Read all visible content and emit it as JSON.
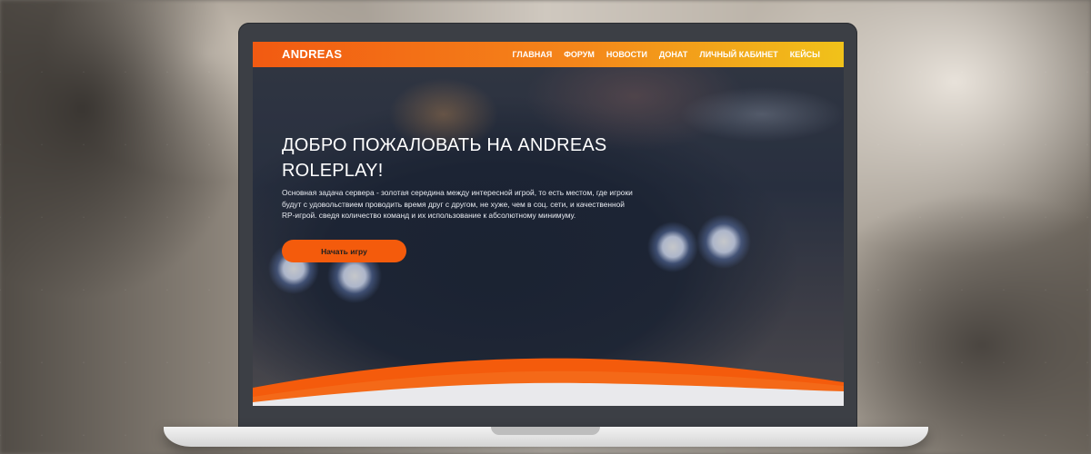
{
  "site": {
    "logo": "ANDREAS"
  },
  "nav": {
    "items": [
      {
        "label": "ГЛАВНАЯ"
      },
      {
        "label": "ФОРУМ"
      },
      {
        "label": "НОВОСТИ"
      },
      {
        "label": "ДОНАТ"
      },
      {
        "label": "ЛИЧНЫЙ КАБИНЕТ"
      },
      {
        "label": "КЕЙСЫ"
      }
    ]
  },
  "hero": {
    "title_line1": "ДОБРО ПОЖАЛОВАТЬ НА ANDREAS",
    "title_line2": "ROLEPLAY!",
    "description": "Основная задача сервера - золотая середина между интересной игрой, то есть местом, где игроки будут с удовольствием проводить время друг с другом, не хуже, чем в соц. сети, и качественной RP-игрой. сведя количество команд и их использование к абсолютному минимуму.",
    "button_label": "Начать игру"
  },
  "colors": {
    "accent": "#f45b0c",
    "nav_gradient_start": "#f25a12",
    "nav_gradient_end": "#f1c21a",
    "laptop_frame": "#3c3f45"
  }
}
